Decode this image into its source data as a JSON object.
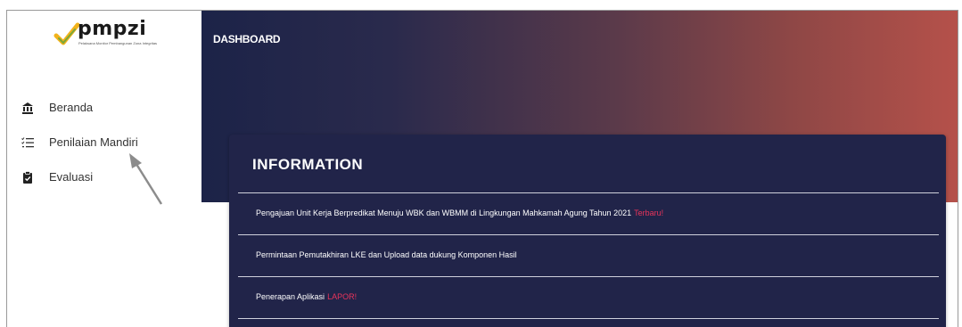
{
  "app": {
    "logo_text": "pmpzi",
    "logo_subtitle": "Pelaksana Monitor Pembangunan Zona Integritas"
  },
  "sidebar": {
    "items": [
      {
        "label": "Beranda",
        "icon": "bank-icon"
      },
      {
        "label": "Penilaian Mandiri",
        "icon": "checklist-icon"
      },
      {
        "label": "Evaluasi",
        "icon": "clipboard-icon"
      }
    ]
  },
  "header": {
    "title": "DASHBOARD"
  },
  "information": {
    "title": "INFORMATION",
    "items": [
      {
        "text": "Pengajuan Unit Kerja Berpredikat Menuju WBK dan WBMM di Lingkungan Mahkamah Agung Tahun 2021",
        "tag": "Terbaru!"
      },
      {
        "text": "Permintaan Pemutakhiran LKE dan Upload data dukung Komponen Hasil",
        "tag": ""
      },
      {
        "text": "Penerapan Aplikasi",
        "tag": "LAPOR!"
      }
    ]
  },
  "colors": {
    "card_bg": "#212449",
    "tag": "#e8345b",
    "header_start": "#1c2348",
    "header_end": "#b5514a"
  }
}
